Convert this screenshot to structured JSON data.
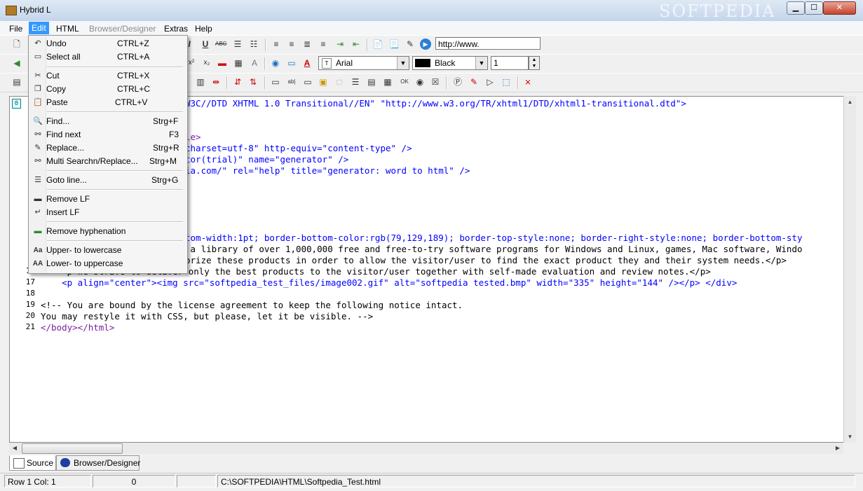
{
  "window": {
    "title": "Hybrid L",
    "watermark": "SOFTPEDIA"
  },
  "menubar": {
    "items": [
      "File",
      "Edit",
      "HTML",
      "Browser/Designer",
      "Extras",
      "Help"
    ]
  },
  "toolbar": {
    "url_input_value": "http://www.",
    "font_select_value": "Arial",
    "color_select_value": "Black",
    "size_input_value": "1"
  },
  "editor": {
    "line_numbers": [
      "16",
      "17",
      "18",
      "19",
      "20",
      "21"
    ],
    "marker_label": "0",
    "lines": [
      {
        "frag": [
          "",
          "W3C//DTD XHTML 1.0 Transitional//EN\" \"http://www.w3.org/TR/xhtml1/DTD/xhtml1-transitional.dtd\">"
        ]
      },
      {
        "frag": [
          "le>"
        ]
      },
      {
        "frag": [
          "charset=utf-8\" http-equiv=\"content-type\" />"
        ]
      },
      {
        "frag": [
          "tor(trial)\" name=\"generator\" />"
        ]
      },
      {
        "frag": [
          "ia.com/\" rel=\"help\" title=\"generator: word to html\" />"
        ]
      },
      {
        "frag": [
          "tom-width:1pt; border-bottom-color:rgb(79,129,189); border-top-style:none; border-right-style:none; border-bottom-sty"
        ]
      },
      {
        "frag": [
          " a library of over 1,000,000 free and free-to-try software programs for Windows and Linux, games, Mac software, Windo"
        ]
      },
      {
        "frag": [
          "orize these products in order to allow the visitor/user to find the exact product they and their system needs.</p>"
        ]
      },
      {
        "frag": [
          "    <p>We strive to deliver only the best products to the visitor/user together with self-made evaluation and review notes.</p>"
        ]
      },
      {
        "frag": [
          "    <p align=\"center\"><img src=\"softpedia_test_files/image002.gif\" alt=\"softpedia tested.bmp\" width=\"335\" height=\"144\" /></p> </div>"
        ]
      },
      {
        "frag": [
          ""
        ]
      },
      {
        "frag": [
          "<!-- You are bound by the license agreement to keep the following notice intact."
        ]
      },
      {
        "frag": [
          "You may restyle it with CSS, but please, let it be visible. -->"
        ]
      },
      {
        "frag": [
          "</body></html>"
        ]
      }
    ]
  },
  "tabs": [
    {
      "label": "Source"
    },
    {
      "label": "Browser/Designer"
    }
  ],
  "statusbar": {
    "row_label": "Row  1  Col:  1",
    "count": "0",
    "path": "C:\\SOFTPEDIA\\HTML\\Softpedia_Test.html"
  },
  "edit_menu": {
    "items": [
      {
        "label": "Undo",
        "shortcut": "CTRL+Z",
        "icon": "undo-icon"
      },
      {
        "label": "Select all",
        "shortcut": "CTRL+A",
        "icon": "select-all-icon"
      },
      {
        "label": "Cut",
        "shortcut": "CTRL+X",
        "icon": "scissors-icon"
      },
      {
        "label": "Copy",
        "shortcut": "CTRL+C",
        "icon": "copy-icon"
      },
      {
        "label": "Paste",
        "shortcut": "CTRL+V",
        "icon": "paste-icon"
      },
      {
        "label": "Find...",
        "shortcut": "Strg+F",
        "icon": "magnifier-icon"
      },
      {
        "label": "Find next",
        "shortcut": "F3",
        "icon": "binoculars-icon"
      },
      {
        "label": "Replace...",
        "shortcut": "Strg+R",
        "icon": "replace-icon"
      },
      {
        "label": "Multi Searchn/Replace...",
        "shortcut": "Strg+M",
        "icon": "multi-search-icon"
      },
      {
        "label": "Goto line...",
        "shortcut": "Strg+G",
        "icon": "goto-icon"
      },
      {
        "label": "Remove LF",
        "shortcut": "",
        "icon": "remove-lf-icon"
      },
      {
        "label": "Insert LF",
        "shortcut": "",
        "icon": "insert-lf-icon"
      },
      {
        "label": "Remove hyphenation",
        "shortcut": "",
        "icon": "hyphen-icon"
      },
      {
        "label": "Upper- to lowercase",
        "shortcut": "",
        "icon": "case-lower-icon"
      },
      {
        "label": "Lower- to uppercase",
        "shortcut": "",
        "icon": "case-upper-icon"
      }
    ]
  }
}
